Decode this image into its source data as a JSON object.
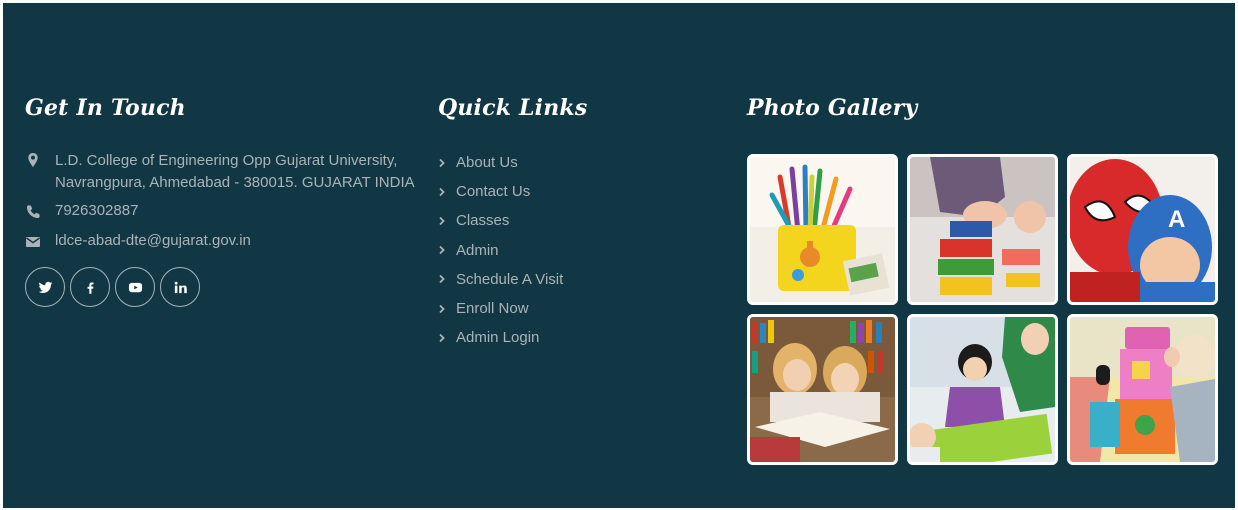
{
  "contact": {
    "heading": "Get In Touch",
    "address": "L.D. College of Engineering Opp Gujarat University, Navrangpura, Ahmedabad - 380015. GUJARAT INDIA",
    "phone": "7926302887",
    "email": "ldce-abad-dte@gujarat.gov.in",
    "social": [
      {
        "name": "twitter",
        "icon": "twitter-icon"
      },
      {
        "name": "facebook",
        "icon": "facebook-icon"
      },
      {
        "name": "youtube",
        "icon": "youtube-icon"
      },
      {
        "name": "linkedin",
        "icon": "linkedin-icon"
      }
    ]
  },
  "links": {
    "heading": "Quick Links",
    "items": [
      {
        "label": "About Us"
      },
      {
        "label": "Contact Us"
      },
      {
        "label": "Classes"
      },
      {
        "label": "Admin"
      },
      {
        "label": "Schedule A Visit"
      },
      {
        "label": "Enroll Now"
      },
      {
        "label": "Admin Login"
      }
    ]
  },
  "gallery": {
    "heading": "Photo Gallery",
    "photos": [
      {
        "subject": "pencil-cup-photo"
      },
      {
        "subject": "building-blocks-photo"
      },
      {
        "subject": "superhero-masks-photo"
      },
      {
        "subject": "kids-reading-photo"
      },
      {
        "subject": "child-drawing-photo"
      },
      {
        "subject": "toy-house-photo"
      }
    ]
  },
  "colors": {
    "background": "#113744",
    "heading": "#ffffff",
    "text": "#aab3b8"
  }
}
